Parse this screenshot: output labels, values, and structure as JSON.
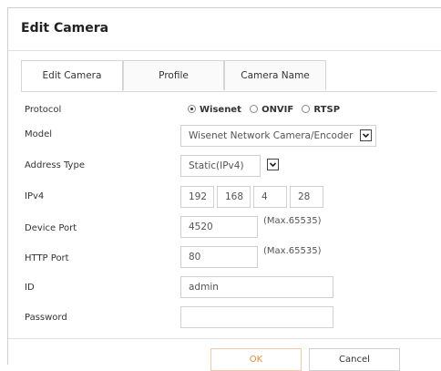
{
  "dialog": {
    "title": "Edit Camera"
  },
  "tabs": [
    {
      "label": "Edit Camera",
      "active": true
    },
    {
      "label": "Profile",
      "active": false
    },
    {
      "label": "Camera Name",
      "active": false
    }
  ],
  "form": {
    "protocol": {
      "label": "Protocol",
      "options": [
        "Wisenet",
        "ONVIF",
        "RTSP"
      ],
      "selected": "Wisenet"
    },
    "model": {
      "label": "Model",
      "value": "Wisenet Network Camera/Encoder"
    },
    "address_type": {
      "label": "Address Type",
      "value": "Static(IPv4)"
    },
    "ipv4": {
      "label": "IPv4",
      "octets": [
        "192",
        "168",
        "4",
        "28"
      ]
    },
    "device_port": {
      "label": "Device Port",
      "value": "4520",
      "hint": "(Max.65535)"
    },
    "http_port": {
      "label": "HTTP Port",
      "value": "80",
      "hint": "(Max.65535)"
    },
    "id": {
      "label": "ID",
      "value": "admin"
    },
    "password": {
      "label": "Password",
      "value": ""
    }
  },
  "buttons": {
    "ok": "OK",
    "cancel": "Cancel"
  },
  "colors": {
    "ok_text": "#e8893e",
    "ok_border": "#f5c8a8",
    "border": "#d0d0d0"
  },
  "icons": {
    "dropdown": "chevron-down-icon",
    "radio": "radio-icon"
  }
}
